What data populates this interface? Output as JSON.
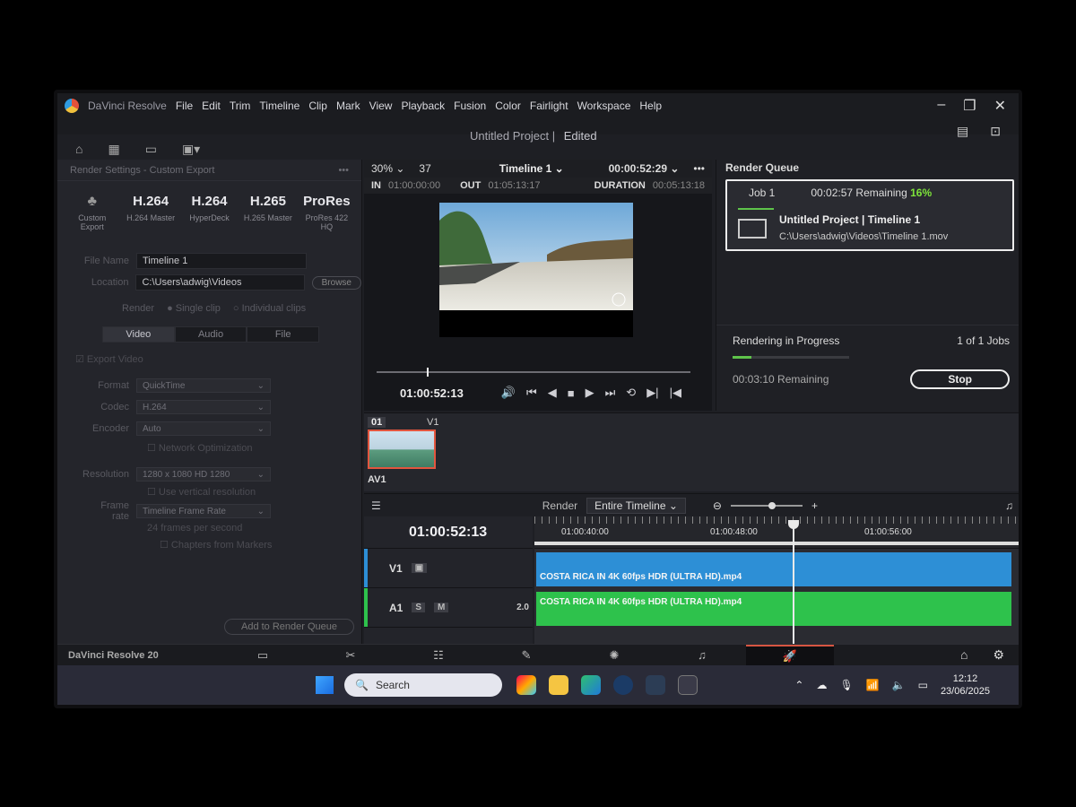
{
  "menu": {
    "app_name": "DaVinci Resolve",
    "items": [
      "File",
      "Edit",
      "Trim",
      "Timeline",
      "Clip",
      "Mark",
      "View",
      "Playback",
      "Fusion",
      "Color",
      "Fairlight",
      "Workspace",
      "Help"
    ]
  },
  "project": {
    "title": "Untitled Project",
    "status": "Edited"
  },
  "render_settings": {
    "panel_title": "Render Settings - Custom Export",
    "presets": [
      {
        "name": "",
        "sub": "Custom Export"
      },
      {
        "name": "H.264",
        "sub": "H.264 Master"
      },
      {
        "name": "H.264",
        "sub": "HyperDeck"
      },
      {
        "name": "H.265",
        "sub": "H.265 Master"
      },
      {
        "name": "ProRes",
        "sub": "ProRes 422 HQ"
      }
    ],
    "file_name_label": "File Name",
    "file_name": "Timeline 1",
    "location_label": "Location",
    "location": "C:\\Users\\adwig\\Videos",
    "browse_label": "Browse",
    "render_label": "Render",
    "single_clip": "Single clip",
    "individual_clips": "Individual clips",
    "tabs": [
      "Video",
      "Audio",
      "File"
    ],
    "export_video": "Export Video",
    "format_label": "Format",
    "format": "QuickTime",
    "codec_label": "Codec",
    "codec": "H.264",
    "encoder_label": "Encoder",
    "encoder": "Auto",
    "network_opt": "Network Optimization",
    "resolution_label": "Resolution",
    "resolution": "1280 x 1080 HD 1280",
    "vertical_res": "Use vertical resolution",
    "frame_rate_label": "Frame rate",
    "frame_rate": "Timeline Frame Rate",
    "fps_note": "24 frames per second",
    "chapters": "Chapters from Markers",
    "add_queue": "Add to Render Queue"
  },
  "viewer": {
    "zoom": "30%",
    "frame_count": "37",
    "timeline_name": "Timeline 1",
    "timecode": "00:00:52:29",
    "in_label": "IN",
    "in_tc": "01:00:00:00",
    "out_label": "OUT",
    "out_tc": "01:05:13:17",
    "duration_label": "DURATION",
    "duration_tc": "00:05:13:18",
    "current_tc": "01:00:52:13",
    "scrub_position": 0.16
  },
  "render_queue": {
    "title": "Render Queue",
    "job_label": "Job 1",
    "job_remaining": "00:02:57 Remaining",
    "job_percent": "16%",
    "job_project": "Untitled Project | Timeline 1",
    "job_path": "C:\\Users\\adwig\\Videos\\Timeline 1.mov",
    "progress_title": "Rendering in Progress",
    "jobs_count": "1 of 1 Jobs",
    "total_remaining": "00:03:10 Remaining",
    "progress": 0.16,
    "stop_label": "Stop"
  },
  "clips": {
    "index": "01",
    "track": "V1",
    "label": "AV1"
  },
  "timeline": {
    "render_label": "Render",
    "render_option": "Entire Timeline",
    "current_tc": "01:00:52:13",
    "ruler": [
      "01:00:40:00",
      "01:00:48:00",
      "01:00:56:00"
    ],
    "tracks": [
      {
        "name": "V1",
        "accent": "#2d8fd6"
      },
      {
        "name": "A1",
        "accent": "#2ec24c",
        "level": "2.0",
        "solo": "S",
        "mute": "M"
      }
    ],
    "video_clip": "COSTA RICA IN 4K 60fps HDR (ULTRA HD).mp4",
    "audio_clip": "COSTA RICA IN 4K 60fps HDR (ULTRA HD).mp4"
  },
  "pagebar": {
    "brand": "DaVinci Resolve 20"
  },
  "taskbar": {
    "search_placeholder": "Search",
    "time": "12:12",
    "date": "23/06/2025"
  }
}
